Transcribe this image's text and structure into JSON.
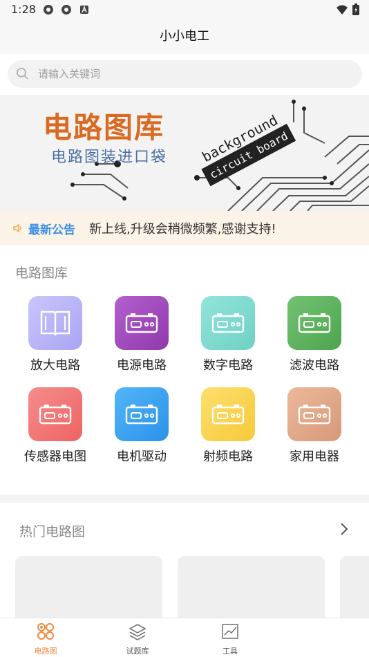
{
  "status_bar": {
    "time": "1:28"
  },
  "app": {
    "title": "小小电工"
  },
  "search": {
    "placeholder": "请输入关键词"
  },
  "banner": {
    "title": "电路图库",
    "subtitle": "电路图装进口袋",
    "tag_line1": "background",
    "tag_line2": "circuit board"
  },
  "notice": {
    "label": "最新公告",
    "text": "新上线,升级会稍微频繁,感谢支持!"
  },
  "library": {
    "title": "电路图库",
    "items": [
      {
        "label": "放大电路",
        "icon": "book-icon",
        "color": "#b6b3f7"
      },
      {
        "label": "电源电路",
        "icon": "battery-icon",
        "color": "#a34fc0"
      },
      {
        "label": "数字电路",
        "icon": "battery-icon",
        "color": "#7edbd0"
      },
      {
        "label": "滤波电路",
        "icon": "battery-icon",
        "color": "#5fb25f"
      },
      {
        "label": "传感器电图",
        "icon": "battery-icon",
        "color": "#f27a7a"
      },
      {
        "label": "电机驱动",
        "icon": "battery-icon",
        "color": "#3aa6f2"
      },
      {
        "label": "射频电路",
        "icon": "battery-icon",
        "color": "#f9d04a"
      },
      {
        "label": "家用电器",
        "icon": "battery-icon",
        "color": "#e2a98a"
      }
    ]
  },
  "hot": {
    "title": "热门电路图"
  },
  "tabbar": {
    "items": [
      {
        "label": "电路图",
        "icon": "grid-circles-icon",
        "active": true
      },
      {
        "label": "试题库",
        "icon": "layers-icon",
        "active": false
      },
      {
        "label": "工具",
        "icon": "chart-icon",
        "active": false
      }
    ]
  },
  "colors": {
    "accent": "#f08a3c",
    "notice_label": "#3f8fe6",
    "banner_title": "#d86a22",
    "banner_sub": "#4a6fa6"
  }
}
